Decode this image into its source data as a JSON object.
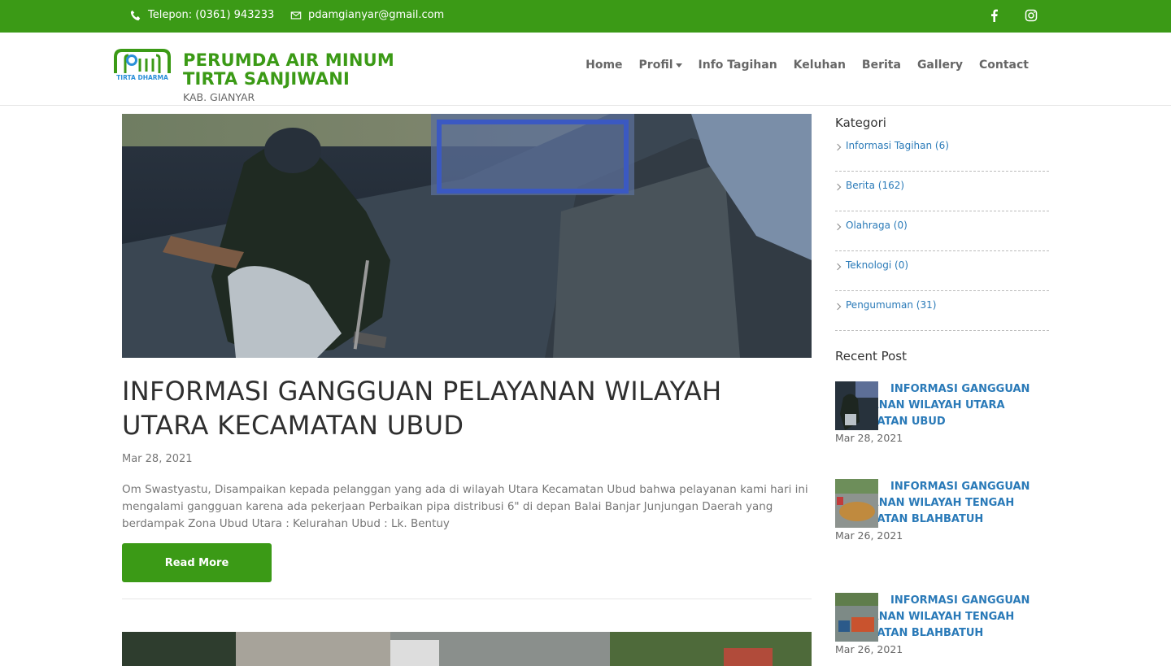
{
  "topbar": {
    "phone": "Telepon: (0361) 943233",
    "email": "pdamgianyar@gmail.com",
    "colors": {
      "bar": "#3b9a16"
    }
  },
  "header": {
    "logo_caption": "TIRTA DHARMA",
    "brand_line1": "PERUMDA AIR MINUM",
    "brand_line2": "TIRTA SANJIWANI",
    "brand_line3": "KAB. GIANYAR",
    "nav": [
      "Home",
      "Profil",
      "Info Tagihan",
      "Keluhan",
      "Berita",
      "Gallery",
      "Contact"
    ]
  },
  "post": {
    "title": "INFORMASI GANGGUAN PELAYANAN WILAYAH UTARA KECAMATAN UBUD",
    "date": "Mar 28, 2021",
    "excerpt": "Om Swastyastu,  Disampaikan kepada pelanggan yang ada di wilayah Utara Kecamatan Ubud bahwa pelayanan kami hari ini mengalami gangguan karena ada pekerjaan  Perbaikan pipa distribusi 6\" di depan Balai Banjar Junjungan Daerah yang berdampak Zona Ubud Utara : Kelurahan Ubud : Lk. Bentuy",
    "read_more": "Read More"
  },
  "sidebar": {
    "kategori_heading": "Kategori",
    "categories": [
      "Informasi Tagihan (6)",
      "Berita (162)",
      "Olahraga (0)",
      "Teknologi (0)",
      "Pengumuman (31)"
    ],
    "recent_heading": "Recent Post",
    "recent": [
      {
        "title": "INFORMASI GANGGUAN PELAYANAN WILAYAH UTARA KECAMATAN UBUD",
        "date": "Mar 28, 2021"
      },
      {
        "title": "INFORMASI GANGGUAN PELAYANAN WILAYAH TENGAH KECAMATAN BLAHBATUH",
        "date": "Mar 26, 2021"
      },
      {
        "title": "INFORMASI GANGGUAN PELAYANAN WILAYAH TENGAH KECAMATAN BLAHBATUH",
        "date": "Mar 26, 2021"
      }
    ]
  },
  "icons": [
    "phone-icon",
    "envelope-icon",
    "facebook-icon",
    "instagram-icon",
    "caret-down-icon",
    "chevron-right-icon"
  ]
}
